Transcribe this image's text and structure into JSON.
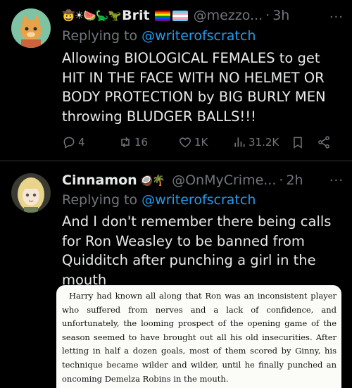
{
  "tweets": [
    {
      "display_name": "Brit",
      "name_emojis": "🤠☀🍉🦕🦖",
      "handle": "@mezzo...",
      "separator": "·",
      "time": "3h",
      "replying_prefix": "Replying to ",
      "replying_to": "@writerofscratch",
      "text": "Allowing BIOLOGICAL FEMALES to get HIT IN THE FACE WITH NO HELMET OR BODY PROTECTION by BIG BURLY MEN throwing BLUDGER BALLS!!!",
      "stats": {
        "replies": "4",
        "retweets": "16",
        "likes": "1K",
        "views": "31.2K"
      }
    },
    {
      "display_name": "Cinnamon",
      "name_emojis": "🥥🌴",
      "handle": "@OnMyCrime...",
      "separator": "·",
      "time": "2h",
      "replying_prefix": "Replying to ",
      "replying_to": "@writerofscratch",
      "text": "And I don't remember there being calls for Ron Weasley to be banned from Quidditch after punching a girl in the mouth",
      "quote_image_text": "Harry had known all along that Ron was an inconsistent player who suffered from nerves and a lack of confidence, and unfortunately, the looming prospect of the opening game of the season seemed to have brought out all his old insecurities. After letting in half a dozen goals, most of them scored by Ginny, his technique became wilder and wilder, until he finally punched an oncoming Demelza Robins in the mouth."
    }
  ],
  "icons": {
    "more": "more-options-icon",
    "reply": "reply-icon",
    "retweet": "retweet-icon",
    "like": "like-icon",
    "views": "views-icon",
    "bookmark": "bookmark-icon",
    "share": "share-icon"
  },
  "colors": {
    "background": "#000000",
    "text": "#e7e9ea",
    "muted": "#71767b",
    "link": "#1d9bf0",
    "divider": "#2f3336"
  }
}
